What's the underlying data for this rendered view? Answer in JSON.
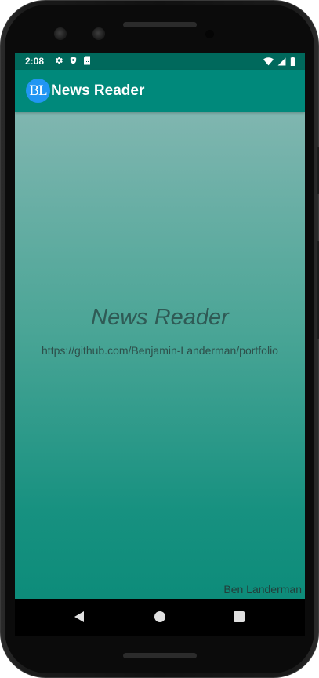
{
  "status_bar": {
    "time": "2:08",
    "left_icons": [
      "gear-icon",
      "shield-icon",
      "sim-card-icon"
    ],
    "right_icons": [
      "wifi-icon",
      "cell-signal-icon",
      "battery-icon"
    ],
    "color": "#00695c"
  },
  "app_bar": {
    "logo_text": "BL",
    "title": "News Reader",
    "color": "#00897b",
    "logo_color": "#2196f3"
  },
  "splash": {
    "title": "News Reader",
    "url": "https://github.com/Benjamin-Landerman/portfolio",
    "author": "Ben Landerman"
  },
  "nav_bar": {
    "buttons": [
      "back-icon",
      "home-icon",
      "recents-icon"
    ]
  }
}
